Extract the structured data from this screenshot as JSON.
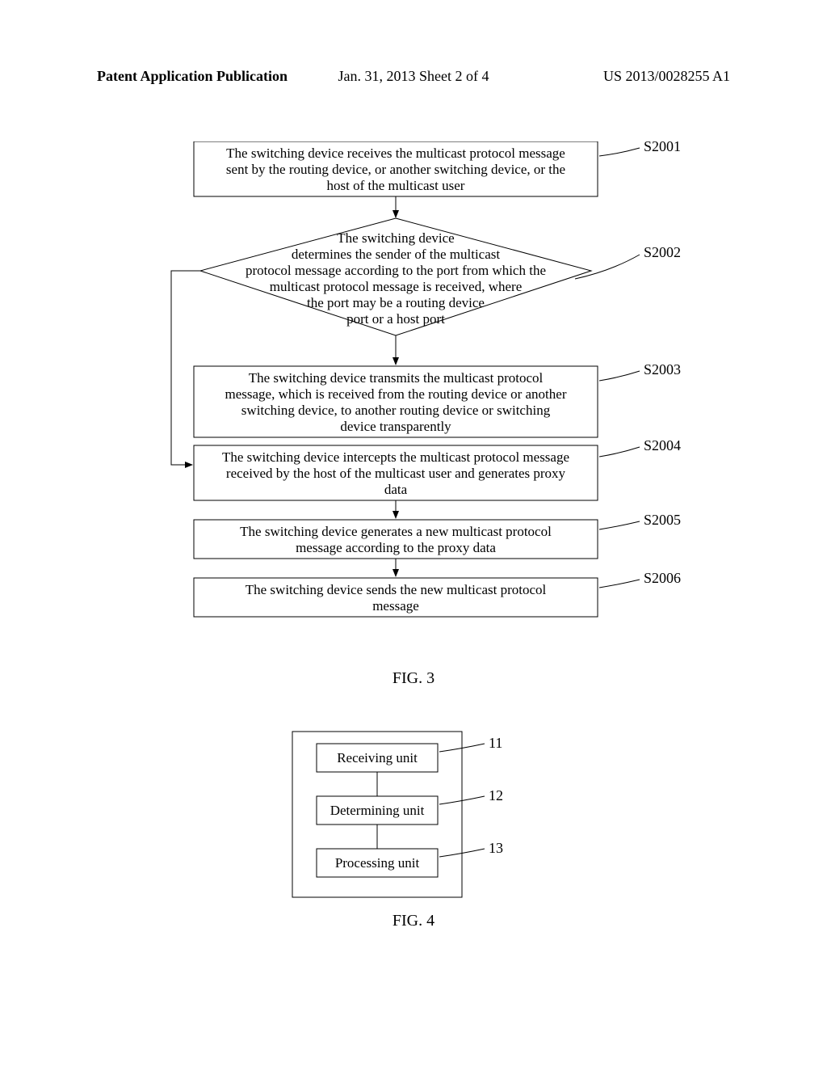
{
  "header": {
    "left": "Patent Application Publication",
    "center": "Jan. 31, 2013  Sheet 2 of 4",
    "right": "US 2013/0028255 A1"
  },
  "fig3": {
    "caption": "FIG. 3",
    "steps": {
      "s2001": {
        "label": "S2001",
        "line1": "The switching device receives the multicast protocol message",
        "line2": "sent by the routing device, or another switching device, or the",
        "line3": "host of the multicast user"
      },
      "s2002": {
        "label": "S2002",
        "line1": "The switching device",
        "line2": "determines the sender of the multicast",
        "line3": "protocol message according to the port from which the",
        "line4": "multicast protocol message is received, where",
        "line5": "the port may be a routing device",
        "line6": "port or a host port"
      },
      "s2003": {
        "label": "S2003",
        "line1": "The switching device transmits the multicast protocol",
        "line2": "message, which is received from the routing device or another",
        "line3": "switching device, to another routing device or switching",
        "line4": "device transparently"
      },
      "s2004": {
        "label": "S2004",
        "line1": "The switching device intercepts the multicast protocol message",
        "line2": "received by the host of the multicast user and generates proxy",
        "line3": "data"
      },
      "s2005": {
        "label": "S2005",
        "line1": "The switching device generates a new multicast protocol",
        "line2": "message according to the proxy data"
      },
      "s2006": {
        "label": "S2006",
        "line1": "The switching device sends the new multicast protocol",
        "line2": "message"
      }
    }
  },
  "fig4": {
    "caption": "FIG. 4",
    "units": {
      "u11": {
        "label": "11",
        "text": "Receiving unit"
      },
      "u12": {
        "label": "12",
        "text": "Determining unit"
      },
      "u13": {
        "label": "13",
        "text": "Processing unit"
      }
    }
  }
}
